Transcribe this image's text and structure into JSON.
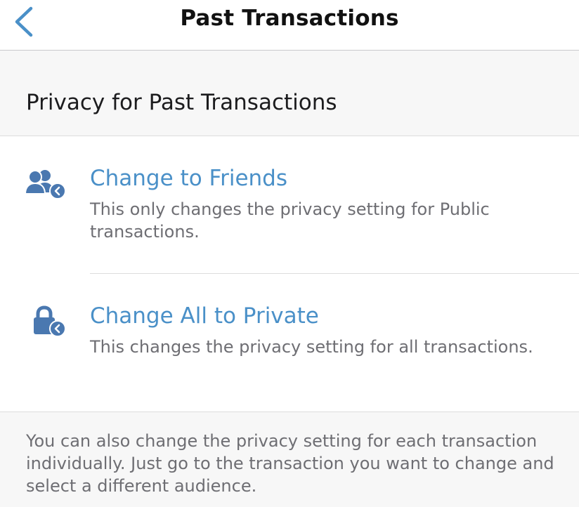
{
  "nav": {
    "title": "Past Transactions",
    "back_icon": "chevron-left-icon"
  },
  "section": {
    "title": "Privacy for Past Transactions"
  },
  "options": [
    {
      "title": "Change to Friends",
      "description": "This only changes the privacy setting for Public transactions.",
      "icon": "friends-icon"
    },
    {
      "title": "Change All to Private",
      "description": "This changes the privacy setting for all transactions.",
      "icon": "lock-icon"
    }
  ],
  "footer": {
    "note": "You can also change the privacy setting for each transaction individually. Just go to the transaction you want to change and select a different audience."
  },
  "colors": {
    "accent": "#4a90c8",
    "icon": "#4a78b0",
    "text_secondary": "#6e6e73"
  }
}
